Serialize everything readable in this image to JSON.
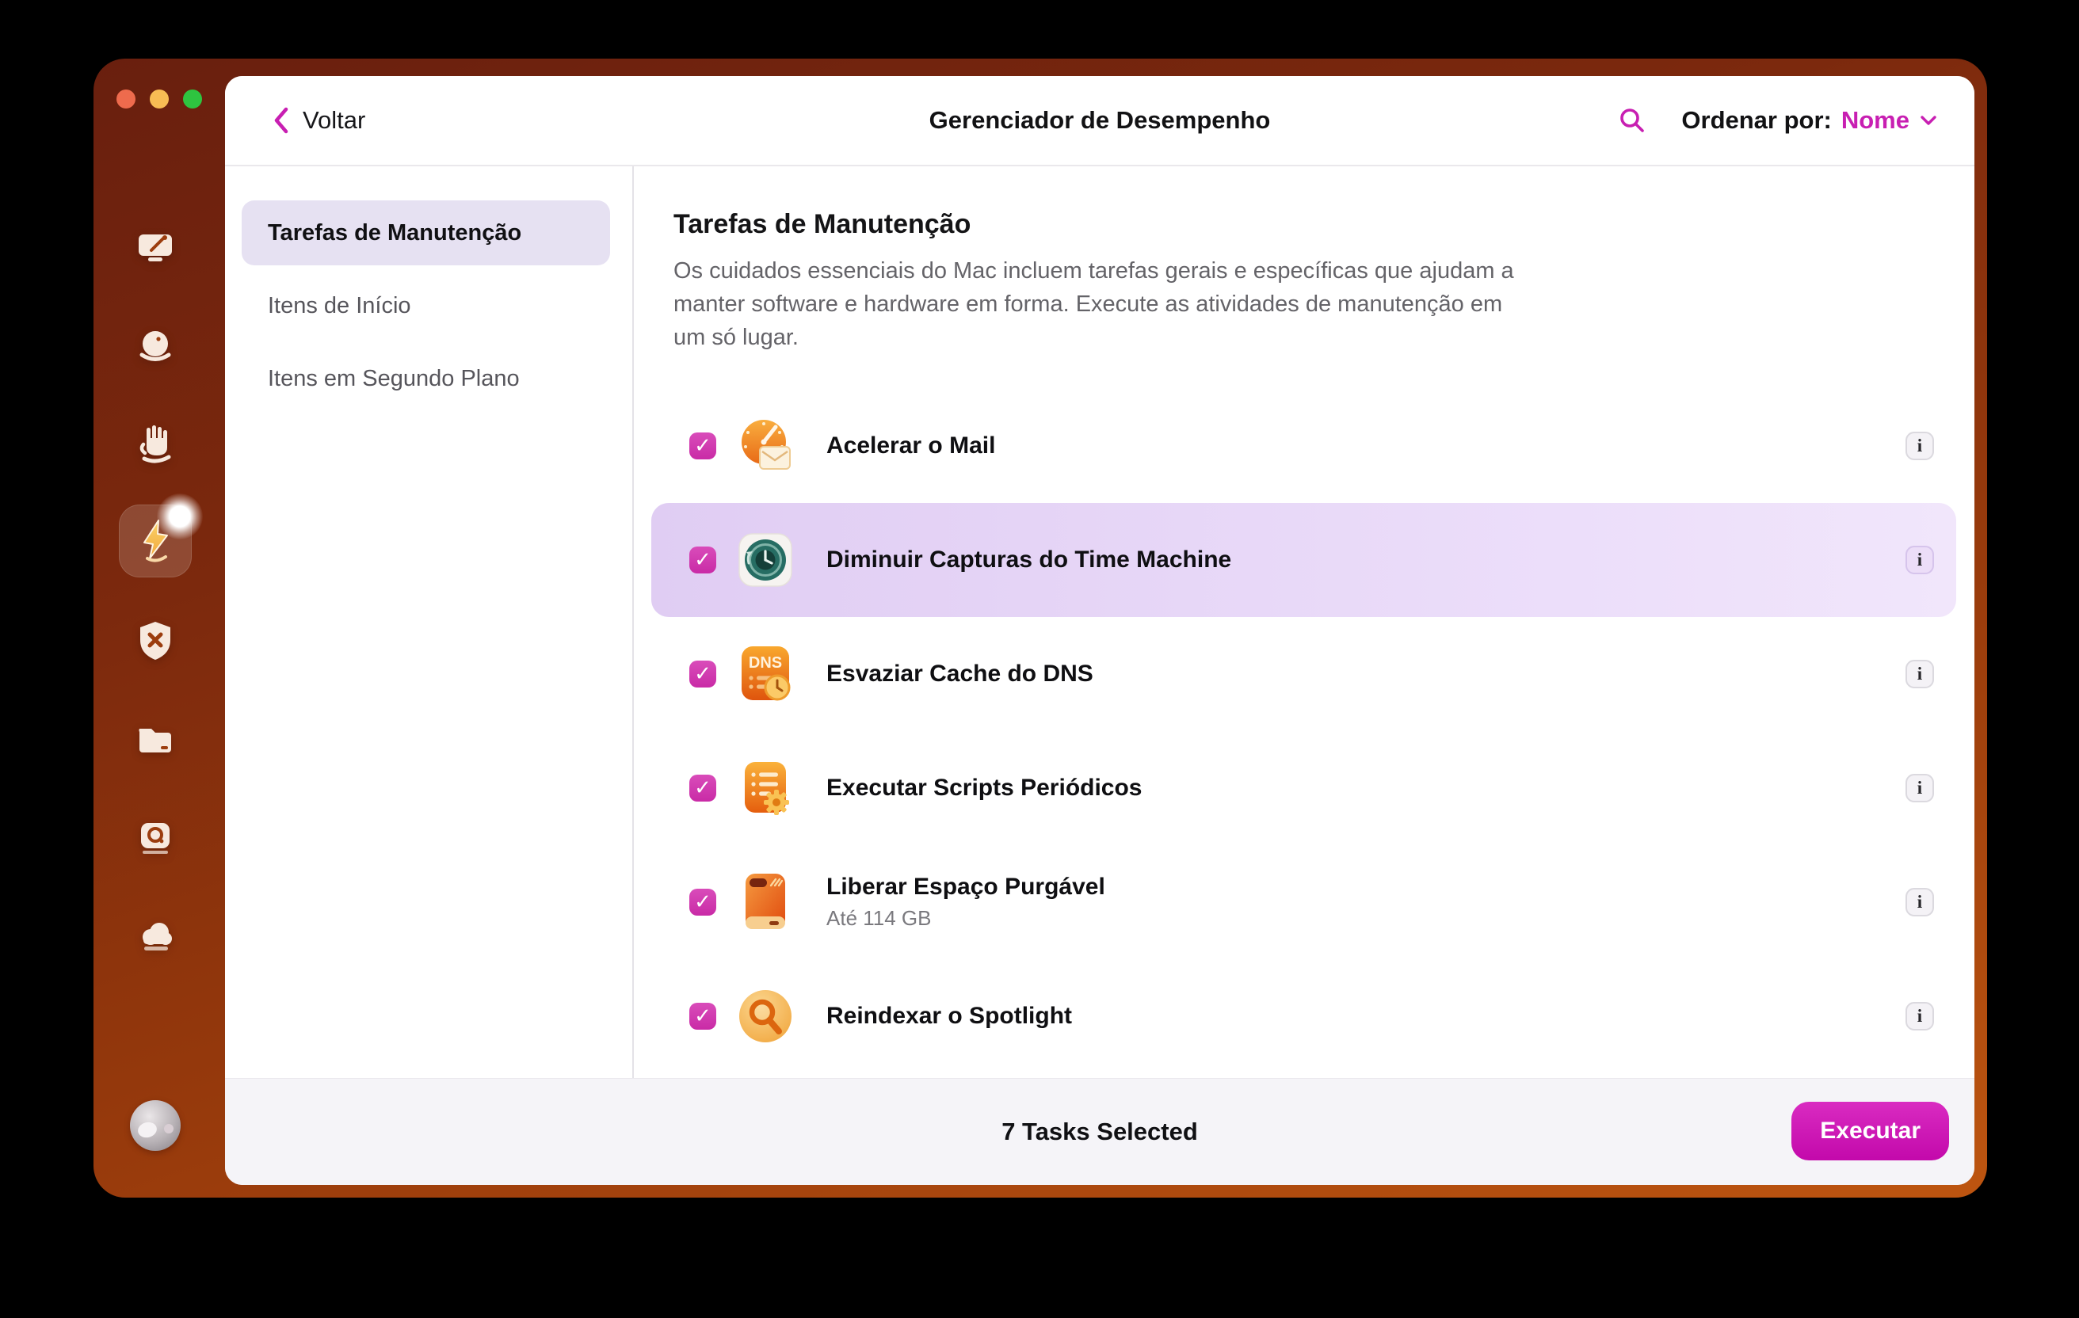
{
  "header": {
    "back_label": "Voltar",
    "title": "Gerenciador de Desempenho",
    "sort_label": "Ordenar por:",
    "sort_value": "Nome"
  },
  "sidebar": {
    "icons": [
      "monitor-cleanup",
      "orb",
      "hand",
      "lightning-performance",
      "shield-x",
      "folder",
      "drive-search",
      "cloud",
      "assistant"
    ]
  },
  "nav": {
    "items": [
      {
        "label": "Tarefas de Manutenção",
        "selected": true
      },
      {
        "label": "Itens de Início",
        "selected": false
      },
      {
        "label": "Itens em Segundo Plano",
        "selected": false
      }
    ]
  },
  "section": {
    "heading": "Tarefas de Manutenção",
    "description": "Os cuidados essenciais do Mac incluem tarefas gerais e específicas que ajudam a manter software e hardware em forma. Execute as atividades de manutenção em um só lugar."
  },
  "tasks": {
    "items": [
      {
        "label": "Acelerar o Mail",
        "checked": true,
        "highlighted": false,
        "icon": "mail-speedometer"
      },
      {
        "label": "Diminuir Capturas do Time Machine",
        "checked": true,
        "highlighted": true,
        "icon": "time-machine"
      },
      {
        "label": "Esvaziar Cache do DNS",
        "checked": true,
        "highlighted": false,
        "icon": "dns-cache",
        "icon_text": "DNS"
      },
      {
        "label": "Executar Scripts Periódicos",
        "checked": true,
        "highlighted": false,
        "icon": "maintenance-scripts"
      },
      {
        "label": "Liberar Espaço Purgável",
        "sublabel": "Até 114 GB",
        "checked": true,
        "highlighted": false,
        "icon": "purgeable-drive"
      },
      {
        "label": "Reindexar o Spotlight",
        "checked": true,
        "highlighted": false,
        "icon": "spotlight-search"
      }
    ]
  },
  "footer": {
    "status": "7 Tasks Selected",
    "run_label": "Executar"
  },
  "glyphs": {
    "check": "✓",
    "info": "i"
  },
  "colors": {
    "accent_magenta": "#C81FB2",
    "button_magenta": "#C309AB",
    "highlight_row": "#E6D4F7",
    "nav_selected_bg": "#E6E1F2",
    "frame_top": "#691F0E",
    "frame_bottom": "#BD5510",
    "footer_bg": "#F5F4F8"
  }
}
